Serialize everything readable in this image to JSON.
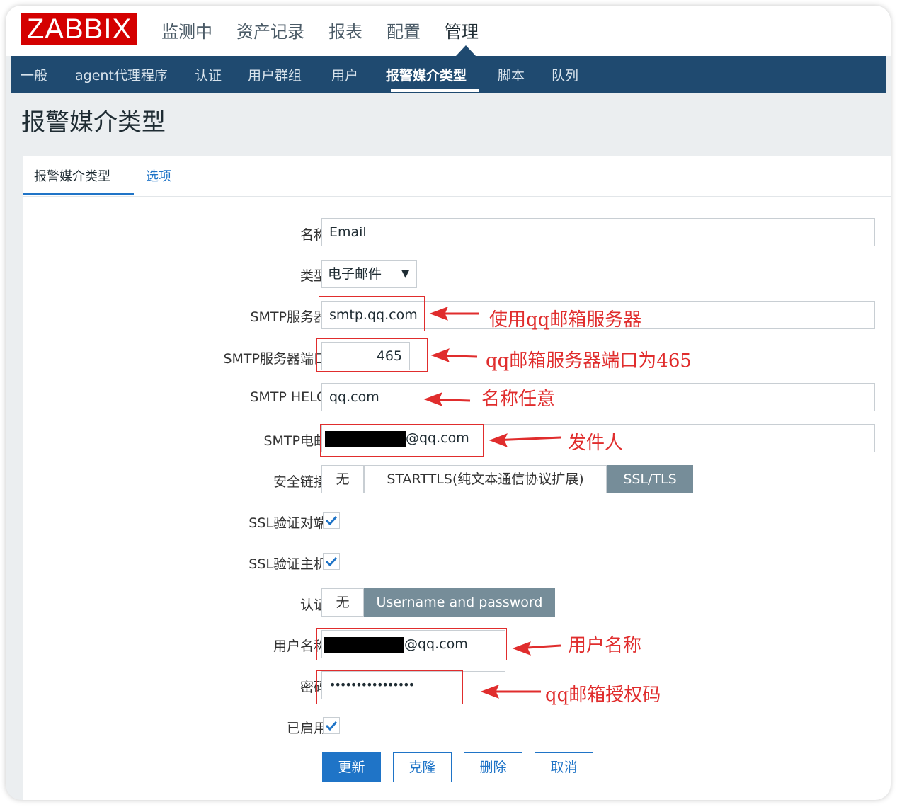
{
  "brand": {
    "logo": "ZABBIX"
  },
  "top_menu": [
    "监测中",
    "资产记录",
    "报表",
    "配置",
    "管理"
  ],
  "sub_nav": [
    "一般",
    "agent代理程序",
    "认证",
    "用户群组",
    "用户",
    "报警媒介类型",
    "脚本",
    "队列"
  ],
  "page": {
    "title": "报警媒介类型"
  },
  "tabs": [
    "报警媒介类型",
    "选项"
  ],
  "form": {
    "name": {
      "label": "名称",
      "value": "Email"
    },
    "type": {
      "label": "类型",
      "value": "电子邮件"
    },
    "smtp_server": {
      "label": "SMTP服务器",
      "value": "smtp.qq.com"
    },
    "smtp_port": {
      "label": "SMTP服务器端口",
      "value": "465"
    },
    "smtp_helo": {
      "label": "SMTP HELO",
      "value": "qq.com"
    },
    "smtp_email": {
      "label": "SMTP电邮",
      "value_suffix": "@qq.com"
    },
    "security": {
      "label": "安全链接",
      "options": [
        "无",
        "STARTTLS(纯文本通信协议扩展)",
        "SSL/TLS"
      ],
      "selected": "SSL/TLS"
    },
    "ssl_verify_peer": {
      "label": "SSL验证对端",
      "checked": true
    },
    "ssl_verify_host": {
      "label": "SSL验证主机",
      "checked": true
    },
    "auth": {
      "label": "认证",
      "options": [
        "无",
        "Username and password"
      ],
      "selected": "Username and password"
    },
    "username": {
      "label": "用户名称",
      "value_suffix": "@qq.com"
    },
    "password": {
      "label": "密码",
      "value": "••••••••••••••••"
    },
    "enabled": {
      "label": "已启用",
      "checked": true
    }
  },
  "buttons": {
    "update": "更新",
    "clone": "克隆",
    "delete": "删除",
    "cancel": "取消"
  },
  "annotations": {
    "smtp_server": "使用qq邮箱服务器",
    "smtp_port": "qq邮箱服务器端口为465",
    "smtp_helo": "名称任意",
    "smtp_email": "发件人",
    "username": "用户名称",
    "password": "qq邮箱授权码"
  },
  "colors": {
    "brand_red": "#d40000",
    "nav_blue": "#1f4a70",
    "accent_blue": "#1f74c7",
    "annotation_red": "#e02d2d",
    "segment_on": "#768d99"
  }
}
